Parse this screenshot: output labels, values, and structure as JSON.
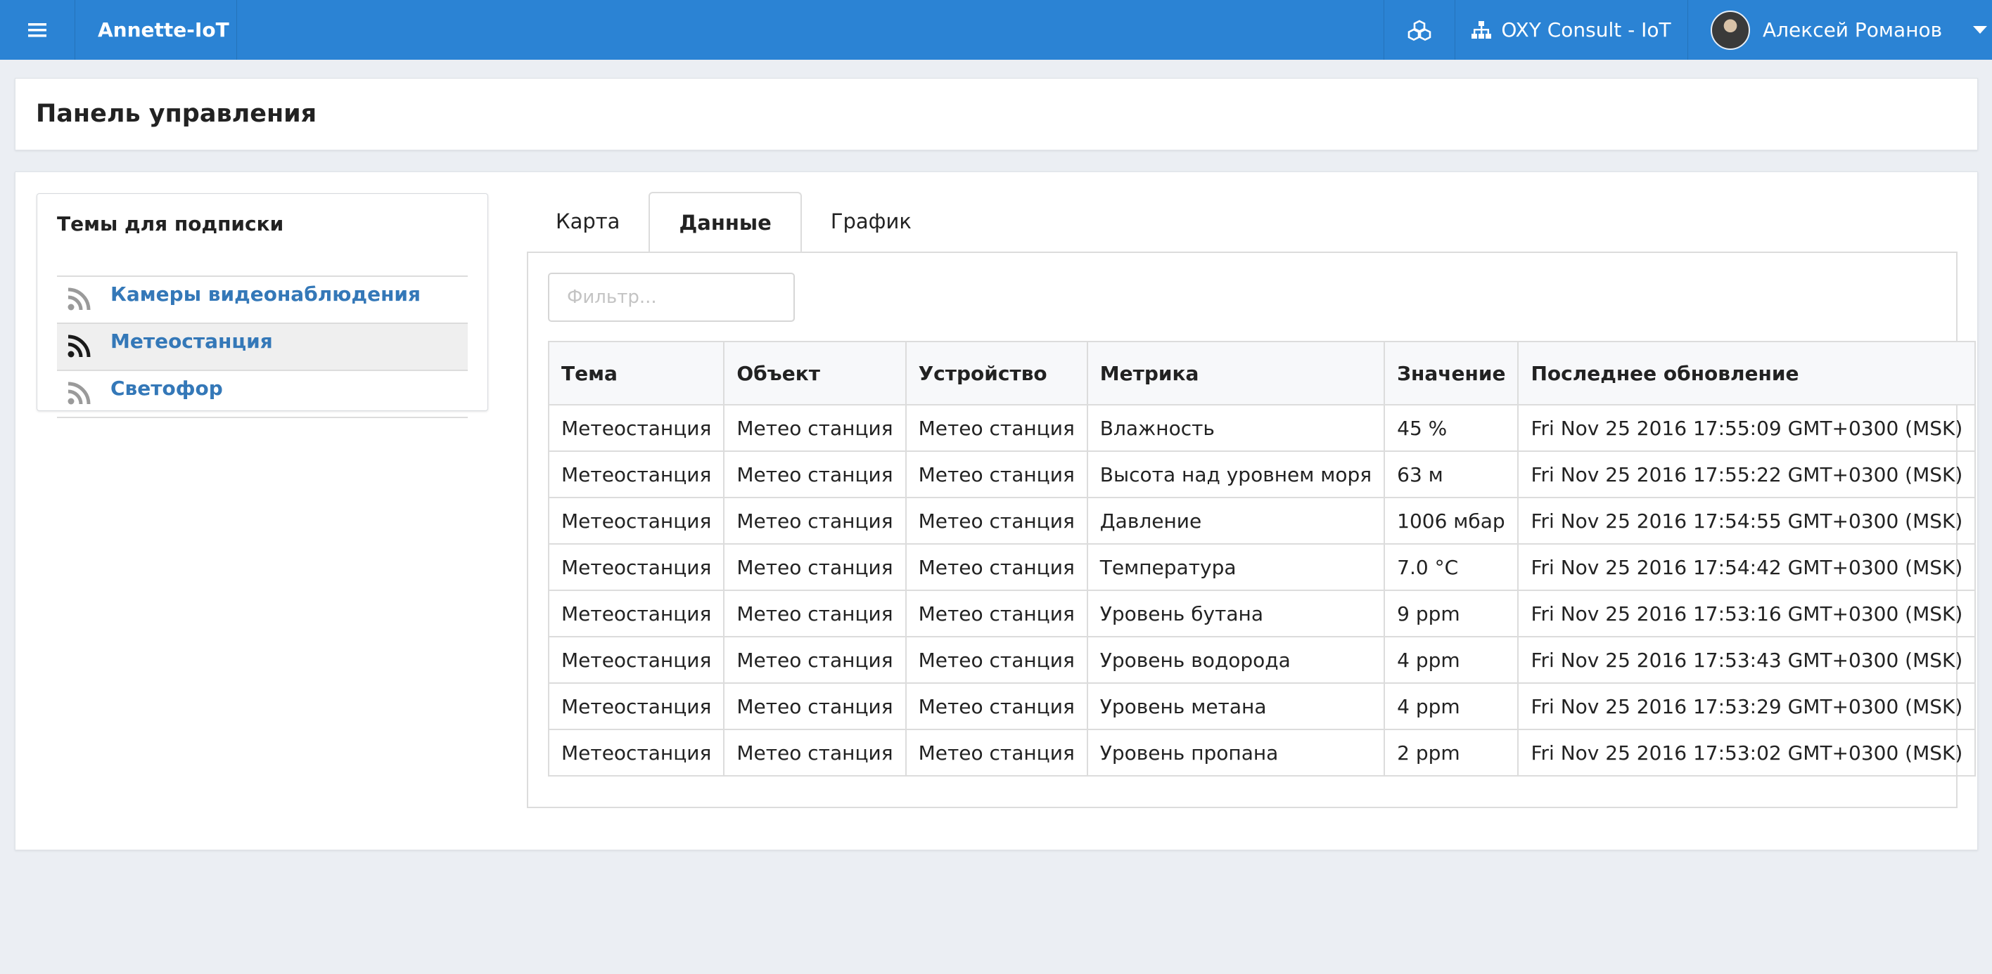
{
  "topbar": {
    "brand": "Annette-IoT",
    "organization": "OXY Consult - IoT",
    "user_name": "Алексей Романов",
    "bg_color": "#2b83d4"
  },
  "header": {
    "title": "Панель управления"
  },
  "topics": {
    "title": "Темы для подписки",
    "items": [
      {
        "label": "Камеры видеонаблюдения",
        "icon": "rss-icon"
      },
      {
        "label": "Метеостанция",
        "icon": "rss-icon",
        "active": true
      },
      {
        "label": "Светофор",
        "icon": "rss-icon"
      }
    ]
  },
  "tabs": [
    {
      "label": "Карта"
    },
    {
      "label": "Данные",
      "active": true
    },
    {
      "label": "График"
    }
  ],
  "filter": {
    "placeholder": "Фильтр..."
  },
  "table": {
    "headers": [
      "Тема",
      "Объект",
      "Устройство",
      "Метрика",
      "Значение",
      "Последнее обновление"
    ],
    "rows": [
      [
        "Метеостанция",
        "Метео станция",
        "Метео станция",
        "Влажность",
        "45 %",
        "Fri Nov 25 2016 17:55:09 GMT+0300 (MSK)"
      ],
      [
        "Метеостанция",
        "Метео станция",
        "Метео станция",
        "Высота над уровнем моря",
        "63 м",
        "Fri Nov 25 2016 17:55:22 GMT+0300 (MSK)"
      ],
      [
        "Метеостанция",
        "Метео станция",
        "Метео станция",
        "Давление",
        "1006 мбар",
        "Fri Nov 25 2016 17:54:55 GMT+0300 (MSK)"
      ],
      [
        "Метеостанция",
        "Метео станция",
        "Метео станция",
        "Температура",
        "7.0 °C",
        "Fri Nov 25 2016 17:54:42 GMT+0300 (MSK)"
      ],
      [
        "Метеостанция",
        "Метео станция",
        "Метео станция",
        "Уровень бутана",
        "9 ppm",
        "Fri Nov 25 2016 17:53:16 GMT+0300 (MSK)"
      ],
      [
        "Метеостанция",
        "Метео станция",
        "Метео станция",
        "Уровень водорода",
        "4 ppm",
        "Fri Nov 25 2016 17:53:43 GMT+0300 (MSK)"
      ],
      [
        "Метеостанция",
        "Метео станция",
        "Метео станция",
        "Уровень метана",
        "4 ppm",
        "Fri Nov 25 2016 17:53:29 GMT+0300 (MSK)"
      ],
      [
        "Метеостанция",
        "Метео станция",
        "Метео станция",
        "Уровень пропана",
        "2 ppm",
        "Fri Nov 25 2016 17:53:02 GMT+0300 (MSK)"
      ]
    ]
  }
}
